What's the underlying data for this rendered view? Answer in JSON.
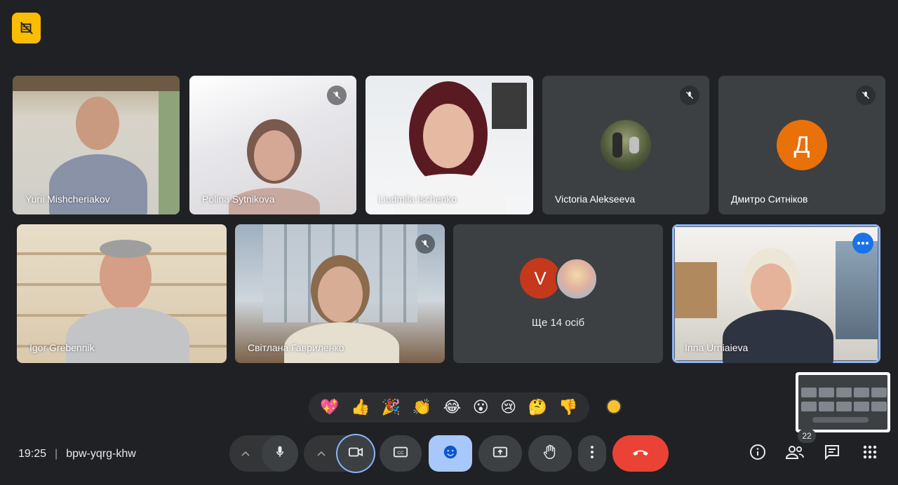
{
  "meeting": {
    "time": "19:25",
    "separator": "|",
    "code": "bpw-yqrg-khw"
  },
  "tiles": [
    {
      "name": "Yurii Mishcheriakov",
      "muted": false
    },
    {
      "name": "Polina Sytnikova",
      "muted": true
    },
    {
      "name": "Liudmila Ischenko",
      "muted": false
    },
    {
      "name": "Victoria Alekseeva",
      "muted": true
    },
    {
      "name": "Дмитро Ситніков",
      "muted": true,
      "avatar_letter": "Д",
      "avatar_color": "#e8710a"
    },
    {
      "name": "Igor Grebennik",
      "muted": false
    },
    {
      "name": "Світлана Гавриленко",
      "muted": true
    },
    {
      "overflow_label": "Ще 14 осіб",
      "avatar_letter": "V",
      "avatar_color": "#c5381c"
    },
    {
      "name": "Inna Urniaieva",
      "muted": false,
      "active": true
    }
  ],
  "reactions": [
    "💖",
    "👍",
    "🎉",
    "👏",
    "😂",
    "😮",
    "😢",
    "🤔",
    "👎"
  ],
  "participant_count": "22",
  "colors": {
    "background": "#202124",
    "tile": "#3c4043",
    "accent": "#8ab4f8",
    "leave": "#ea4335",
    "emoji_active": "#a8c7fa",
    "badge": "#fbbc04"
  },
  "icons": {
    "top_badge": "no-recording-icon",
    "mic": "mic-icon",
    "camera": "camera-icon",
    "captions": "captions-icon",
    "emoji": "emoji-icon",
    "present": "present-icon",
    "hand": "raise-hand-icon",
    "more": "more-vert-icon",
    "leave": "call-end-icon",
    "info": "info-icon",
    "people": "people-icon",
    "chat": "chat-icon",
    "activities": "apps-icon"
  }
}
